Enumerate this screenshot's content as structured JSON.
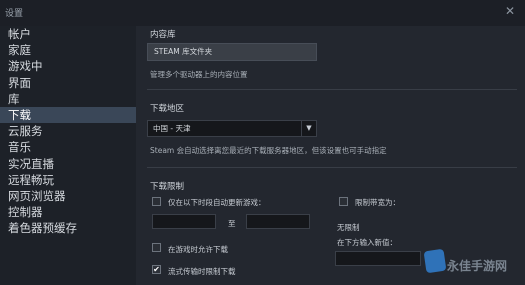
{
  "window": {
    "title": "设置",
    "close_glyph": "✕"
  },
  "sidebar": {
    "items": [
      {
        "label": "帐户"
      },
      {
        "label": "家庭"
      },
      {
        "label": "游戏中"
      },
      {
        "label": "界面"
      },
      {
        "label": "库"
      },
      {
        "label": "下载",
        "active": true
      },
      {
        "label": "云服务"
      },
      {
        "label": "音乐"
      },
      {
        "label": "实况直播"
      },
      {
        "label": "远程畅玩"
      },
      {
        "label": "网页浏览器"
      },
      {
        "label": "控制器"
      },
      {
        "label": "着色器预缓存"
      }
    ]
  },
  "content_library": {
    "title": "内容库",
    "button_label": "STEAM 库文件夹",
    "description": "管理多个驱动器上的内容位置"
  },
  "download_region": {
    "title": "下载地区",
    "selected": "中国 - 天津",
    "note": "Steam 会自动选择离您最近的下载服务器地区，但该设置也可手动指定"
  },
  "download_limits": {
    "title": "下载限制",
    "auto_update_label": "仅在以下时段自动更新游戏：",
    "to_label": "至",
    "limit_bandwidth_label": "限制带宽为：",
    "unlimited_text": "无限制",
    "enter_new_value_label": "在下方输入新值：",
    "allow_in_game_label": "在游戏时允许下载",
    "throttle_streaming_label": "流式传输时限制下载",
    "throttle_checked": true
  },
  "watermark": {
    "text": "永佳手游网"
  }
}
